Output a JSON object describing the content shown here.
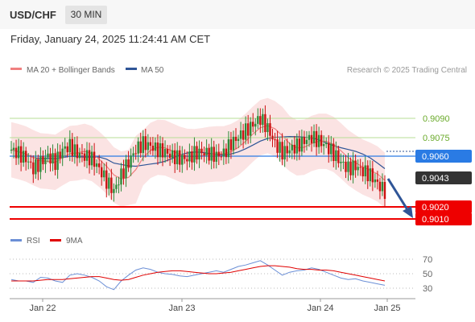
{
  "header": {
    "pair": "USD/CHF",
    "timeframe": "30 MIN",
    "datetime": "Friday, January 24, 2025 11:24:41 AM CET"
  },
  "legend": {
    "ma20_label": "MA 20 + Bollinger Bands",
    "ma50_label": "MA 50",
    "ma20_color": "#f08080",
    "ma50_color": "#2f5597",
    "credit": "Research © 2025 Trading Central"
  },
  "rsi_legend": {
    "rsi_label": "RSI",
    "ma_label": "9MA",
    "rsi_color": "#6b8fd6",
    "ma_color": "#e00000"
  },
  "colors": {
    "bull": "#2e8b3a",
    "bear": "#cc1111",
    "band_fill": "#fbe3e3",
    "level_green": "#b7dc94",
    "level_red": "#ee0000",
    "current_box": "#2a7be4",
    "last_box": "#333333"
  },
  "chart_data": {
    "type": "candlestick",
    "instrument": "USD/CHF",
    "interval": "30 MIN",
    "x_ticks": [
      "Jan 22",
      "Jan 23",
      "Jan 24",
      "Jan 25"
    ],
    "resistance_levels": [
      0.909,
      0.9075
    ],
    "support_levels": [
      0.902,
      0.901
    ],
    "current_level": 0.906,
    "last_price": 0.9043,
    "level_labels": [
      "0.9090",
      "0.9075",
      "0.9060",
      "0.9043",
      "0.9020",
      "0.9010"
    ],
    "projection": {
      "from": 0.9043,
      "to": 0.901,
      "direction": "down"
    },
    "price_approx": [
      0.9065,
      0.9062,
      0.9058,
      0.905,
      0.9055,
      0.906,
      0.9055,
      0.9065,
      0.9068,
      0.9062,
      0.906,
      0.9058,
      0.905,
      0.904,
      0.9032,
      0.9045,
      0.9055,
      0.9065,
      0.907,
      0.9068,
      0.9065,
      0.9063,
      0.906,
      0.9058,
      0.9058,
      0.9062,
      0.9063,
      0.9062,
      0.906,
      0.9062,
      0.907,
      0.9075,
      0.908,
      0.9085,
      0.909,
      0.9082,
      0.907,
      0.9063,
      0.9065,
      0.9068,
      0.9072,
      0.9075,
      0.9072,
      0.9068,
      0.9062,
      0.9055,
      0.905,
      0.9052,
      0.9048,
      0.9045,
      0.9038,
      0.9032
    ],
    "rsi_axis": {
      "ticks": [
        70,
        50,
        30
      ]
    },
    "rsi_approx": [
      42,
      40,
      40,
      38,
      45,
      44,
      40,
      38,
      48,
      50,
      48,
      45,
      40,
      32,
      28,
      40,
      48,
      55,
      58,
      56,
      52,
      50,
      49,
      47,
      46,
      48,
      50,
      52,
      54,
      52,
      56,
      60,
      62,
      65,
      68,
      62,
      55,
      48,
      52,
      54,
      55,
      58,
      56,
      52,
      48,
      44,
      42,
      43,
      40,
      38,
      36,
      34
    ],
    "rsi_ma9_approx": [
      40,
      40,
      40,
      40,
      41,
      42,
      42,
      42,
      43,
      44,
      45,
      46,
      46,
      44,
      42,
      41,
      42,
      45,
      48,
      50,
      52,
      53,
      54,
      54,
      53,
      52,
      51,
      50,
      50,
      51,
      52,
      54,
      56,
      58,
      60,
      61,
      61,
      60,
      59,
      57,
      56,
      56,
      55,
      55,
      54,
      52,
      50,
      48,
      46,
      44,
      42,
      40
    ]
  }
}
